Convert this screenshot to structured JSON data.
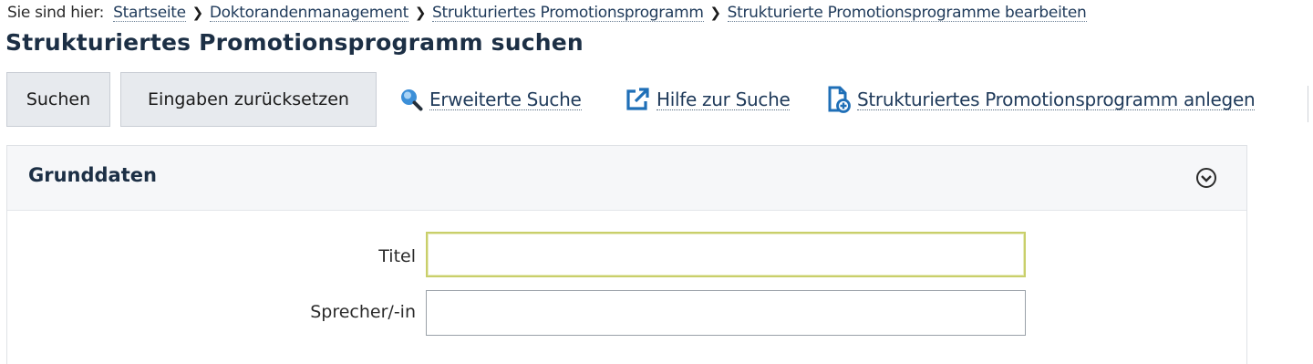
{
  "breadcrumb": {
    "prefix": "Sie sind hier:",
    "items": [
      "Startseite",
      "Doktorandenmanagement",
      "Strukturiertes Promotionsprogramm",
      "Strukturierte Promotionsprogramme bearbeiten"
    ]
  },
  "page_title": "Strukturiertes Promotionsprogramm suchen",
  "toolbar": {
    "search_label": "Suchen",
    "reset_label": "Eingaben zurücksetzen",
    "advanced_search_label": "Erweiterte Suche",
    "help_label": "Hilfe zur Suche",
    "create_label": "Strukturiertes Promotionsprogramm anlegen"
  },
  "panel": {
    "title": "Grunddaten",
    "fields": [
      {
        "label": "Titel",
        "value": ""
      },
      {
        "label": "Sprecher/-in",
        "value": ""
      }
    ]
  },
  "icons": {
    "advanced_search": "magnifier-icon",
    "help": "external-link-icon",
    "create": "new-document-icon",
    "collapse": "chevron-circle-icon"
  },
  "colors": {
    "link": "#1f3a5a",
    "title": "#1c2f45",
    "button_bg": "#e7eaee",
    "accent_icon": "#1f6fb7"
  }
}
